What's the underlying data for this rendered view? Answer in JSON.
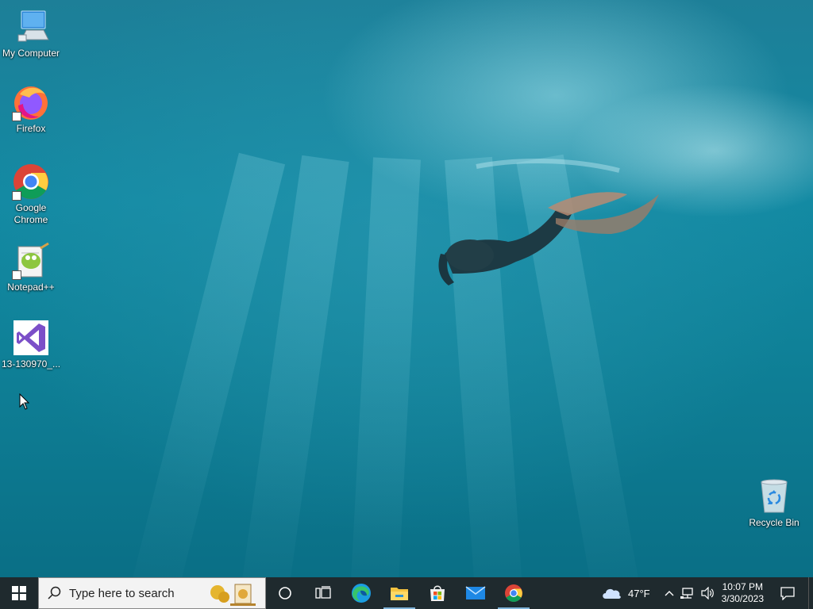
{
  "desktop": {
    "icons": [
      {
        "label": "My Computer",
        "icon": "computer-icon",
        "shortcut": false
      },
      {
        "label": "Firefox",
        "icon": "firefox-icon",
        "shortcut": true
      },
      {
        "label": "Google Chrome",
        "icon": "chrome-icon",
        "shortcut": true
      },
      {
        "label": "Notepad++",
        "icon": "notepadpp-icon",
        "shortcut": true
      },
      {
        "label": "13-130970_...",
        "icon": "visual-studio-icon",
        "shortcut": false
      }
    ],
    "recycle_bin": {
      "label": "Recycle Bin",
      "icon": "recycle-bin-icon"
    }
  },
  "taskbar": {
    "start_icon": "windows-logo-icon",
    "search": {
      "placeholder": "Type here to search"
    },
    "pinned": [
      {
        "name": "cortana",
        "icon": "cortana-circle-icon"
      },
      {
        "name": "task-view",
        "icon": "task-view-icon"
      },
      {
        "name": "edge",
        "icon": "edge-icon"
      },
      {
        "name": "file-explorer",
        "icon": "folder-icon",
        "active": true
      },
      {
        "name": "microsoft-store",
        "icon": "store-icon"
      },
      {
        "name": "mail",
        "icon": "mail-icon"
      },
      {
        "name": "chrome",
        "icon": "chrome-icon",
        "active": true
      }
    ],
    "tray": {
      "weather": {
        "temp": "47°F",
        "icon": "cloud-icon"
      },
      "time": "10:07 PM",
      "date": "3/30/2023"
    }
  },
  "colors": {
    "taskbar_bg": "#1f2a2e",
    "active_indicator": "#7fb3d9",
    "wallpaper_base": "#0f8198"
  }
}
